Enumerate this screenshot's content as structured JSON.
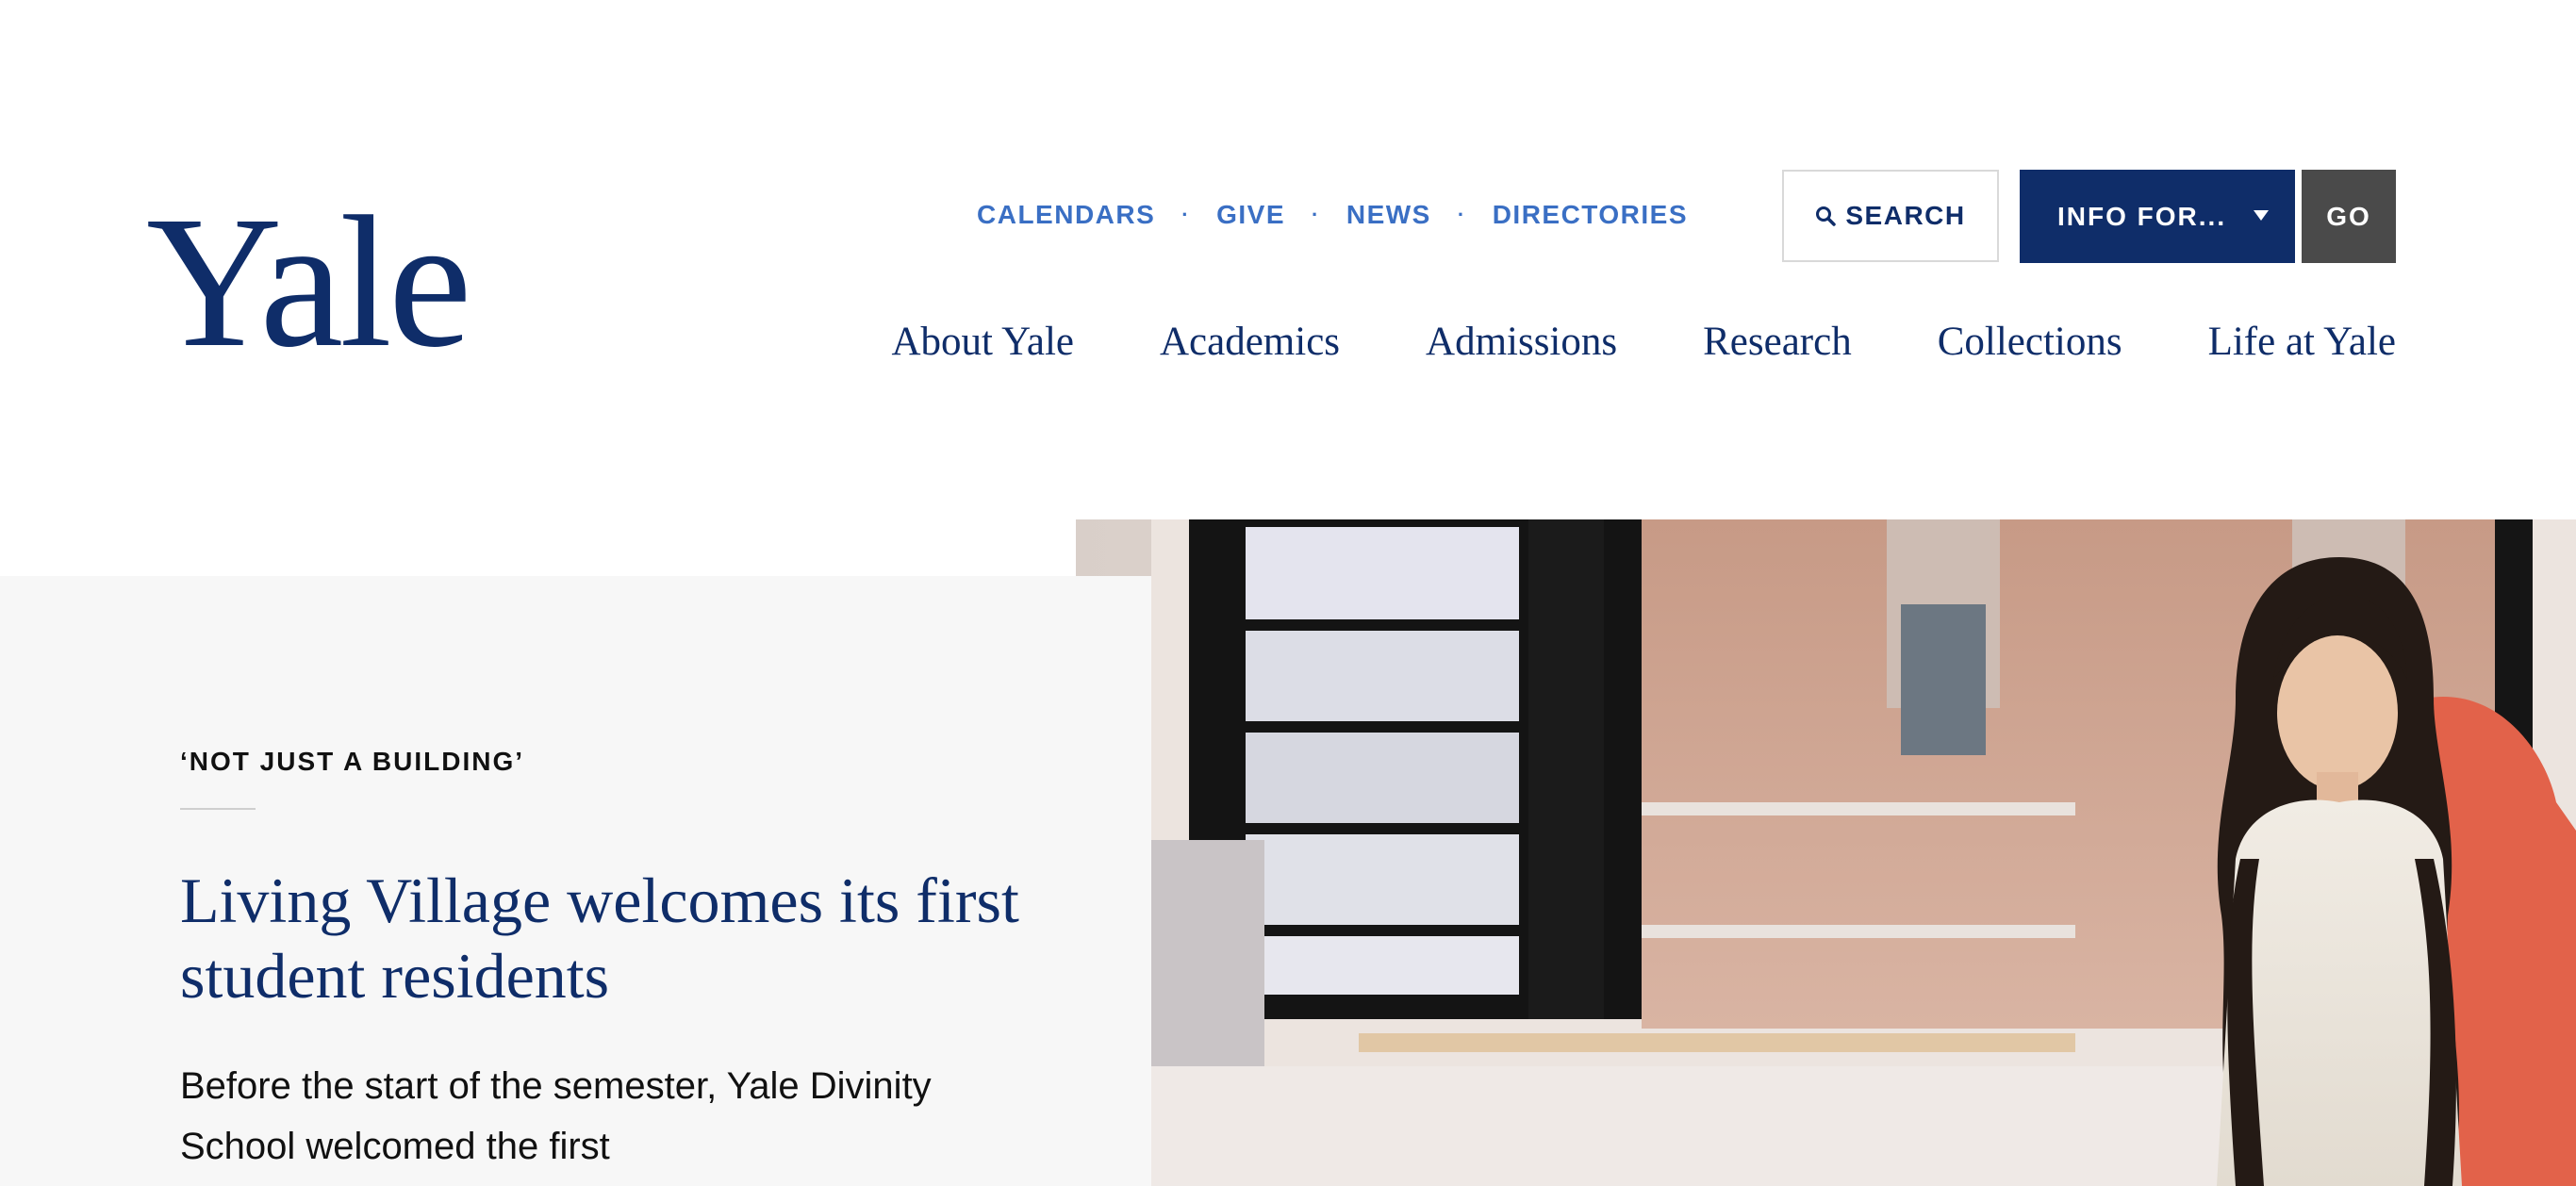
{
  "logo": {
    "text": "Yale"
  },
  "utility_nav": {
    "items": [
      "CALENDARS",
      "GIVE",
      "NEWS",
      "DIRECTORIES"
    ],
    "separator": "·"
  },
  "search": {
    "label": "SEARCH",
    "icon": "search-icon"
  },
  "info_for": {
    "label": "INFO FOR...",
    "icon": "caret-down-icon"
  },
  "go": {
    "label": "GO"
  },
  "main_nav": {
    "items": [
      "About Yale",
      "Academics",
      "Admissions",
      "Research",
      "Collections",
      "Life at Yale"
    ]
  },
  "hero": {
    "kicker": "‘NOT JUST A BUILDING’",
    "headline": "Living Village welcomes its first student residents",
    "dek": "Before the start of the semester, Yale Divinity School welcomed the first"
  },
  "colors": {
    "brand_blue": "#0f2d69",
    "link_blue": "#3a6fc4",
    "go_gray": "#4a4a4a",
    "card_bg": "#f7f7f7"
  }
}
